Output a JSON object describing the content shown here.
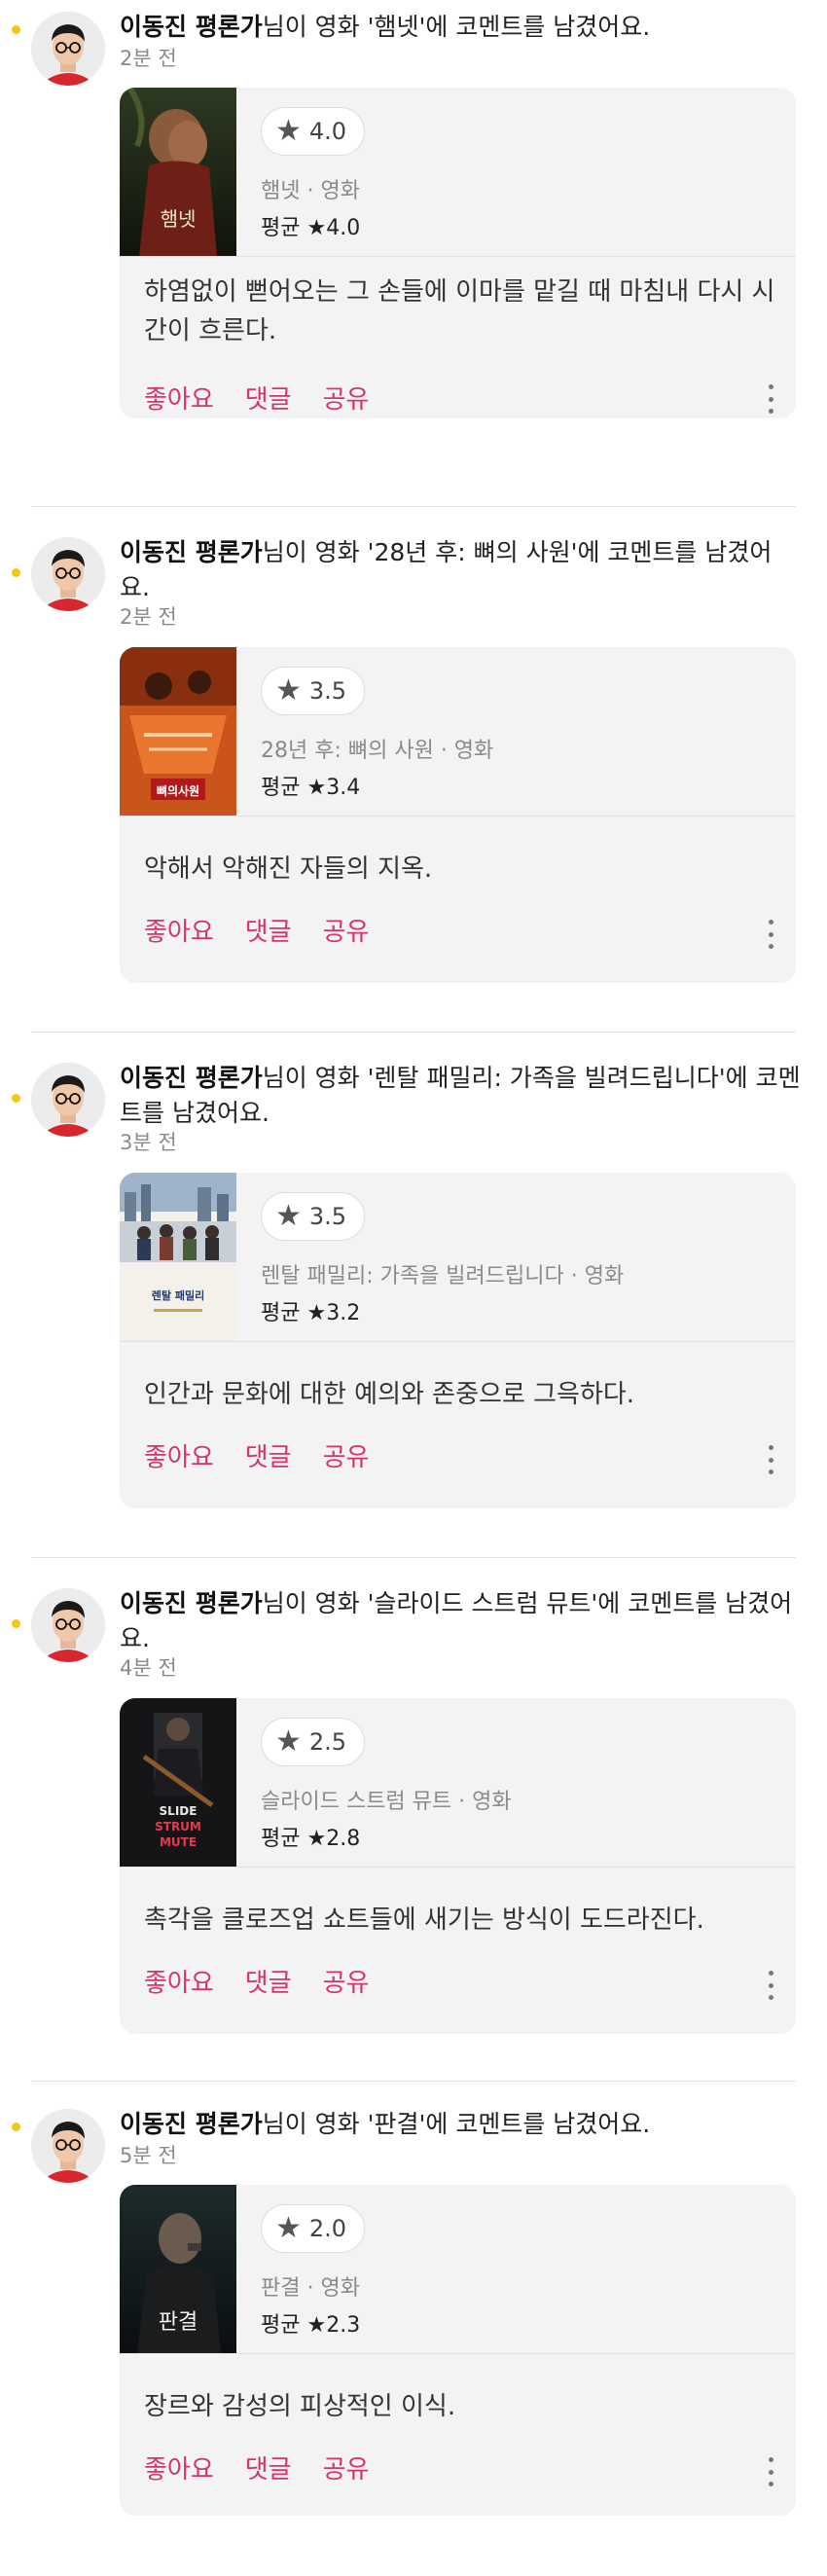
{
  "feed": {
    "accent_color": "#d6336c",
    "unread_dot_color": "#f5c518",
    "items": [
      {
        "author": "이동진 평론가",
        "message_prefix": "님이 영화 ",
        "movie_quoted": "'햄넷'",
        "message_suffix": "에 코멘트를 남겼어요.",
        "time": "2분 전",
        "rating": "4.0",
        "movie_title": "햄넷",
        "category": "영화",
        "subtitle": "햄넷 · 영화",
        "average_label": "평균",
        "average": "★4.0",
        "comment": "하염없이 뻗어오는 그 손들에 이마를 맡길 때 마침내 다시 시간이 흐른다.",
        "poster_text": "햄넷",
        "actions": {
          "like": "좋아요",
          "reply": "댓글",
          "share": "공유"
        }
      },
      {
        "author": "이동진 평론가",
        "message_prefix": "님이 영화 ",
        "movie_quoted": "'28년 후: 뼈의 사원'",
        "message_suffix": "에 코멘트를 남겼어요.",
        "time": "2분 전",
        "rating": "3.5",
        "movie_title": "28년 후: 뼈의 사원",
        "category": "영화",
        "subtitle": "28년 후: 뼈의 사원 · 영화",
        "average_label": "평균",
        "average": "★3.4",
        "comment": "악해서 악해진 자들의 지옥.",
        "poster_text": "뼈의사원",
        "actions": {
          "like": "좋아요",
          "reply": "댓글",
          "share": "공유"
        }
      },
      {
        "author": "이동진 평론가",
        "message_prefix": "님이 영화 ",
        "movie_quoted": "'렌탈 패밀리: 가족을 빌려드립니다'",
        "message_suffix": "에 코멘트를 남겼어요.",
        "time": "3분 전",
        "rating": "3.5",
        "movie_title": "렌탈 패밀리: 가족을 빌려드립니다",
        "category": "영화",
        "subtitle": "렌탈 패밀리: 가족을 빌려드립니다 · 영화",
        "average_label": "평균",
        "average": "★3.2",
        "comment": "인간과 문화에 대한 예의와 존중으로 그윽하다.",
        "poster_text": "렌탈 패밀리",
        "actions": {
          "like": "좋아요",
          "reply": "댓글",
          "share": "공유"
        }
      },
      {
        "author": "이동진 평론가",
        "message_prefix": "님이 영화 ",
        "movie_quoted": "'슬라이드 스트럼 뮤트'",
        "message_suffix": "에 코멘트를 남겼어요.",
        "time": "4분 전",
        "rating": "2.5",
        "movie_title": "슬라이드 스트럼 뮤트",
        "category": "영화",
        "subtitle": "슬라이드 스트럼 뮤트 · 영화",
        "average_label": "평균",
        "average": "★2.8",
        "comment": "촉각을 클로즈업 쇼트들에 새기는 방식이 도드라진다.",
        "poster_text": "SLIDE STRUM MUTE",
        "actions": {
          "like": "좋아요",
          "reply": "댓글",
          "share": "공유"
        }
      },
      {
        "author": "이동진 평론가",
        "message_prefix": "님이 영화 ",
        "movie_quoted": "'판결'",
        "message_suffix": "에 코멘트를 남겼어요.",
        "time": "5분 전",
        "rating": "2.0",
        "movie_title": "판결",
        "category": "영화",
        "subtitle": "판결 · 영화",
        "average_label": "평균",
        "average": "★2.3",
        "comment": "장르와 감성의 피상적인 이식.",
        "poster_text": "판결",
        "actions": {
          "like": "좋아요",
          "reply": "댓글",
          "share": "공유"
        }
      }
    ]
  }
}
